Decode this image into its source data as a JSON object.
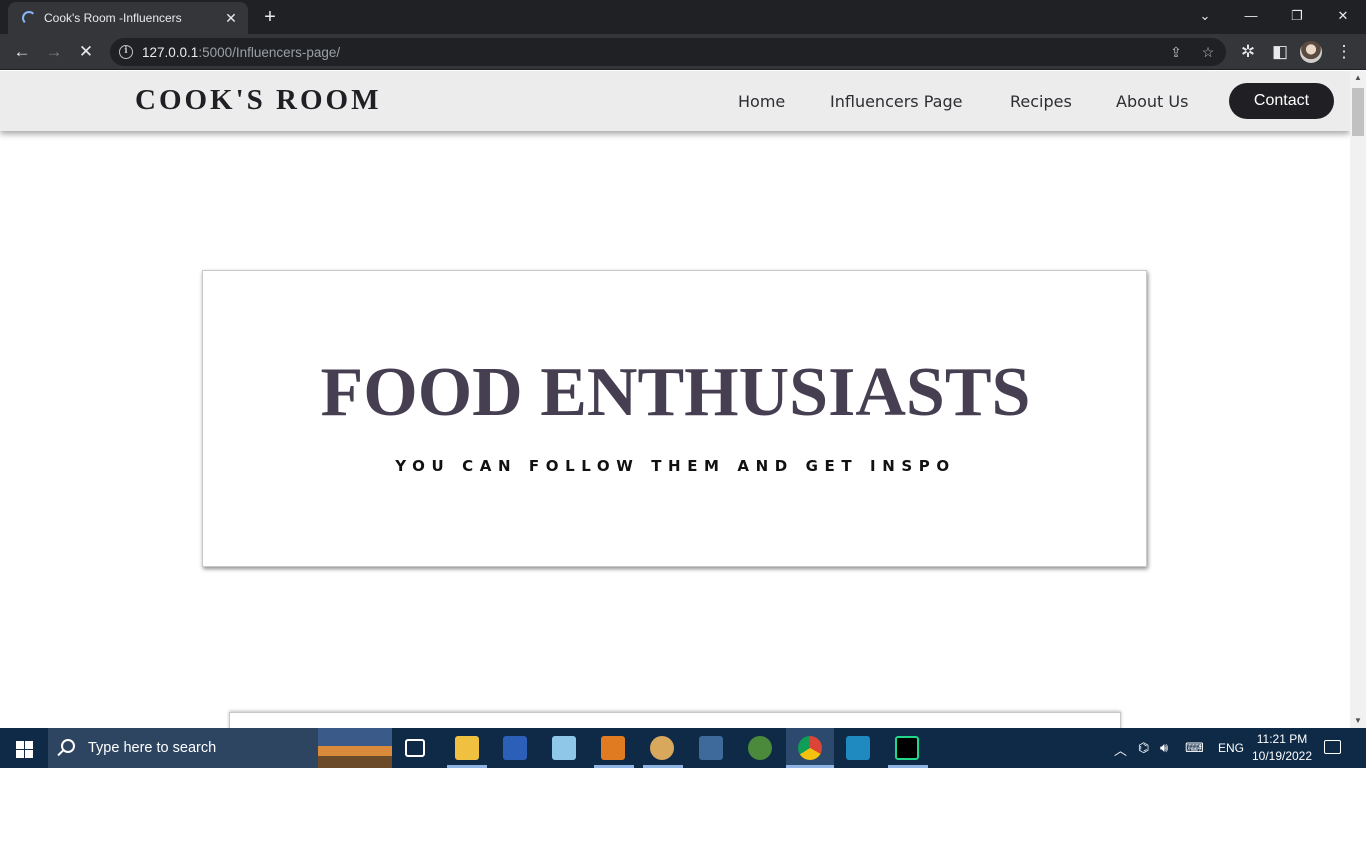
{
  "browser": {
    "tab_title": "Cook's Room -Influencers",
    "url_host": "127.0.0.1",
    "url_path": ":5000/Influencers-page/"
  },
  "site": {
    "logo": "COOK'S ROOM",
    "nav": {
      "home": "Home",
      "influencers": "Influencers Page",
      "recipes": "Recipes",
      "about": "About Us",
      "contact": "Contact"
    },
    "hero": {
      "title": "FOOD ENTHUSIASTS",
      "subtitle": "YOU CAN FOLLOW THEM AND GET INSPO"
    }
  },
  "taskbar": {
    "search_placeholder": "Type here to search",
    "language": "ENG",
    "time": "11:21 PM",
    "date": "10/19/2022"
  },
  "colors": {
    "browser_dark": "#202124",
    "toolbar": "#35363a",
    "nav_background": "#ececec",
    "hero_title": "#463f52",
    "contact_button": "#202024",
    "taskbar": "#0e2a47"
  }
}
